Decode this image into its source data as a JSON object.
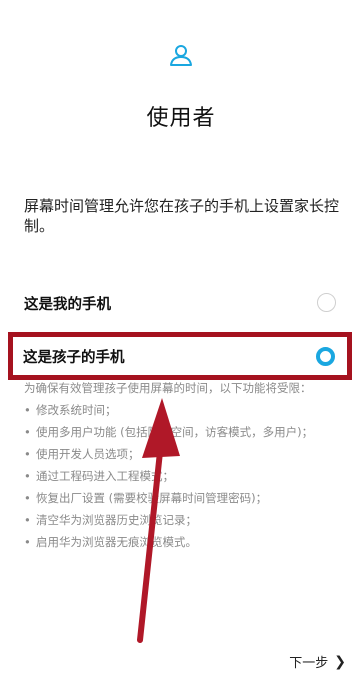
{
  "header": {
    "icon": "user-icon",
    "title": "使用者"
  },
  "description": "屏幕时间管理允许您在孩子的手机上设置家长控制。",
  "options": [
    {
      "label": "这是我的手机",
      "selected": false
    },
    {
      "label": "这是孩子的手机",
      "selected": true
    }
  ],
  "notes": {
    "lead": "为确保有效管理孩子使用屏幕的时间，以下功能将受限：",
    "items": [
      "修改系统时间；",
      "使用多用户功能 (包括隐私空间，访客模式，多用户)；",
      "使用开发人员选项；",
      "通过工程码进入工程模式；",
      "恢复出厂设置 (需要校验屏幕时间管理密码)；",
      "清空华为浏览器历史浏览记录；",
      "启用华为浏览器无痕浏览模式。"
    ]
  },
  "footer": {
    "next_label": "下一步",
    "next_icon": "chevron-right-icon"
  },
  "colors": {
    "accent": "#1aa7e0",
    "highlight": "#a5121f"
  }
}
